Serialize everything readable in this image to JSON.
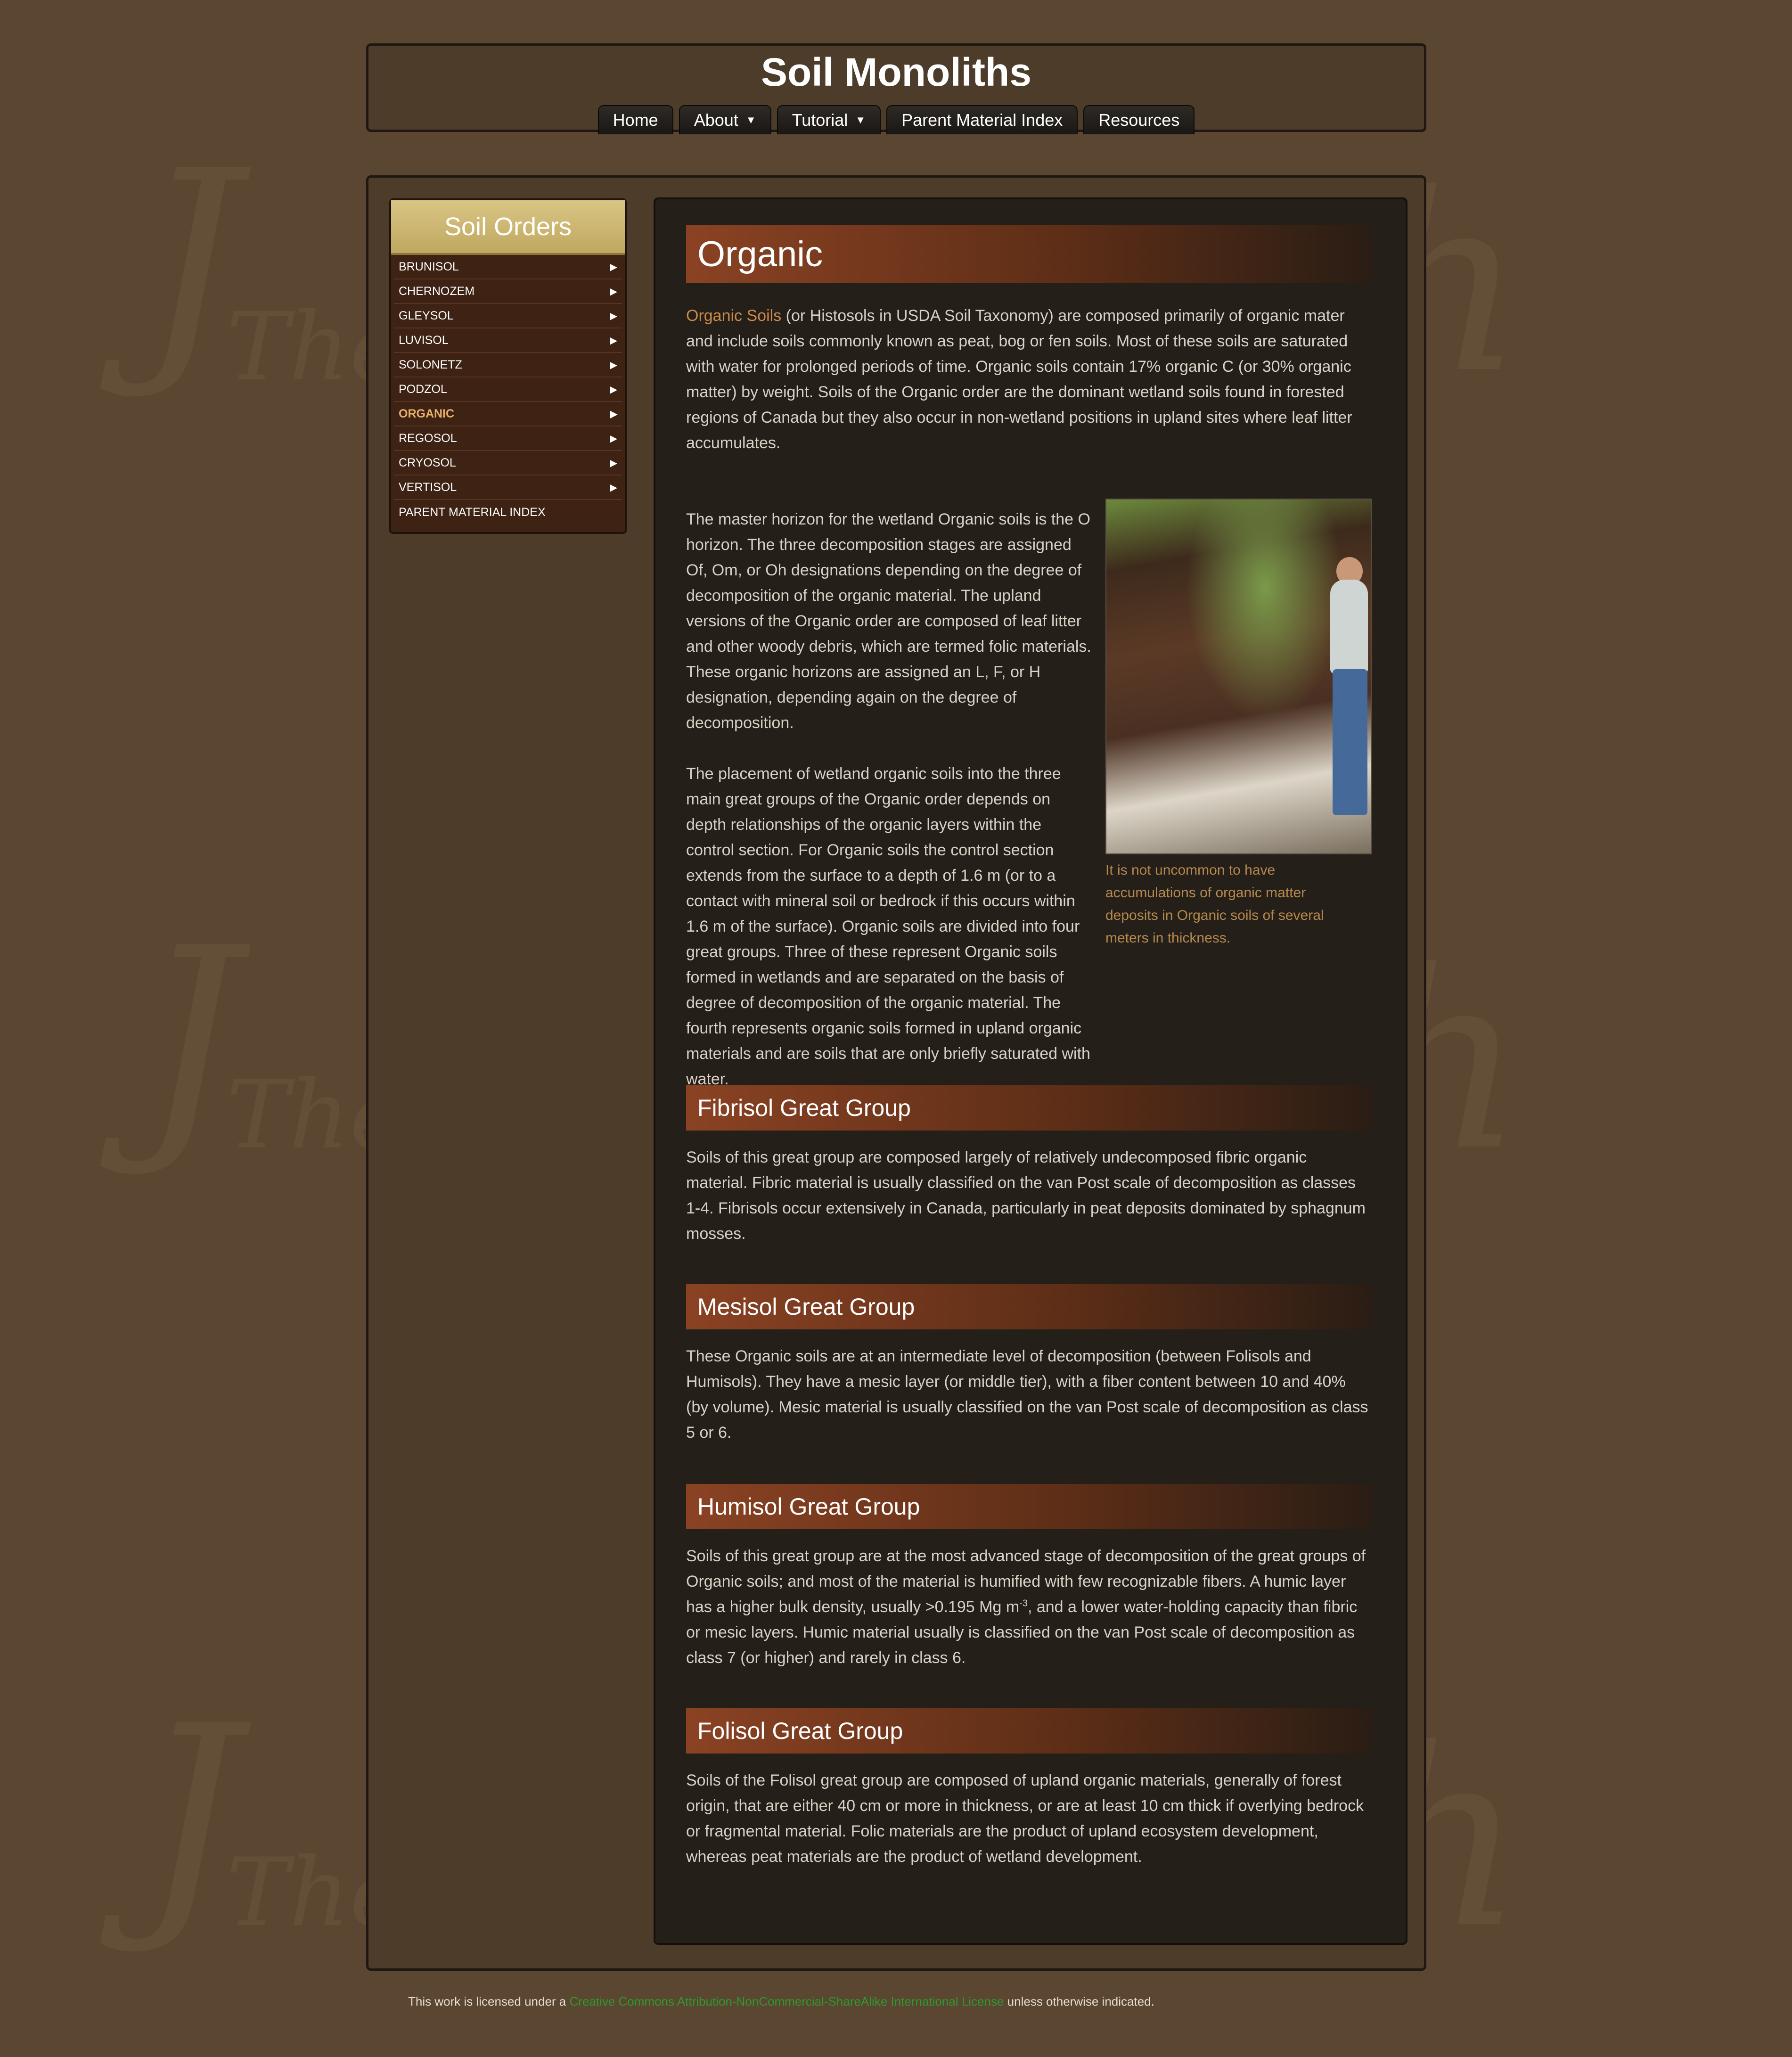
{
  "site": {
    "title": "Soil Monoliths"
  },
  "nav": {
    "home": "Home",
    "about": "About",
    "tutorial": "Tutorial",
    "parent_material_index": "Parent Material Index",
    "resources": "Resources"
  },
  "sidebar": {
    "heading": "Soil Orders",
    "items": [
      {
        "label": "BRUNISOL"
      },
      {
        "label": "CHERNOZEM"
      },
      {
        "label": "GLEYSOL"
      },
      {
        "label": "LUVISOL"
      },
      {
        "label": "SOLONETZ"
      },
      {
        "label": "PODZOL"
      },
      {
        "label": "ORGANIC"
      },
      {
        "label": "REGOSOL"
      },
      {
        "label": "CRYOSOL"
      },
      {
        "label": "VERTISOL"
      },
      {
        "label": "PARENT MATERIAL INDEX"
      }
    ],
    "active": "ORGANIC"
  },
  "content": {
    "title": "Organic",
    "intro_link": "Organic Soils",
    "intro_text": " (or Histosols in USDA Soil Taxonomy) are composed primarily of organic mater and include soils commonly known as peat, bog or fen soils. Most of these soils are saturated with water for prolonged periods of time. Organic soils contain 17% organic C (or 30% organic matter) by weight. Soils of the Organic order are the dominant wetland soils found in forested regions of Canada but they also occur in non-wetland positions in upland sites where leaf litter accumulates.",
    "para2": "The master horizon for the wetland Organic soils is the O horizon. The three decomposition stages are assigned Of, Om, or Oh designations depending on the degree of decomposition of the organic material. The upland versions of the Organic order are composed of leaf litter and other woody debris, which are termed folic materials. These organic horizons are assigned an L, F, or H designation, depending again on the degree of decomposition.",
    "para3": "The placement of wetland organic soils into the three main great groups of the Organic order depends on depth relationships of the organic layers within the control section. For Organic soils the control section extends from the surface to a depth of 1.6 m (or to a contact with mineral soil or bedrock if this occurs within 1.6 m of the surface). Organic soils are divided into four great groups. Three of these represent Organic soils formed in wetlands and are separated on the basis of degree of decomposition of the organic material. The fourth represents organic soils formed in upland organic materials and are soils that are only briefly saturated with water.",
    "photo_caption": "It is not uncommon to have accumulations of organic matter deposits in Organic soils of several meters in thickness.",
    "fibrisol_title": "Fibrisol Great Group",
    "fibrisol_text": "Soils of this great group are composed largely of relatively undecomposed fibric organic material. Fibric material is usually classified on the van Post scale of decomposition as classes 1-4. Fibrisols occur extensively in Canada, particularly in peat deposits dominated by sphagnum mosses.",
    "mesisol_title": "Mesisol Great Group",
    "mesisol_text": "These Organic soils are at an intermediate level of decomposition (between Folisols and Humisols). They have a mesic layer (or middle tier), with a fiber content between 10 and 40% (by volume). Mesic material is usually classified on the van Post scale of decomposition as class 5 or 6.",
    "humisol_title": "Humisol Great Group",
    "humisol_text_a": "Soils of this great group are at the most advanced stage of decomposition of the great groups of Organic soils; and most of the material is humified with few recognizable fibers. A humic layer has a higher bulk density, usually >0.195 Mg m",
    "humisol_sup": "-3",
    "humisol_text_b": ", and a lower water-holding capacity than fibric or mesic layers. Humic material usually is classified on the van Post scale of decomposition as class 7 (or higher) and rarely in class 6.",
    "folisol_title": "Folisol Great Group",
    "folisol_text": "Soils of the Folisol great group are composed of upland organic materials, generally of forest origin, that are either 40 cm or more in thickness, or are at least 10 cm thick if overlying bedrock or fragmental material. Folic materials are the product of upland ecosystem development, whereas peat materials are the product of wetland development."
  },
  "footer": {
    "prefix": "This work is licensed under a ",
    "license_link": "Creative Commons Attribution-NonCommercial-ShareAlike International License",
    "suffix": " unless otherwise indicated."
  },
  "colors": {
    "background": "#5a4631",
    "panel": "#242019",
    "sidebar": "#3e2214",
    "sidebar_header": "#cbb46d",
    "heading_bar": "#8a4223",
    "link": "#cc8a4a",
    "license_link": "#2e9a2e"
  }
}
